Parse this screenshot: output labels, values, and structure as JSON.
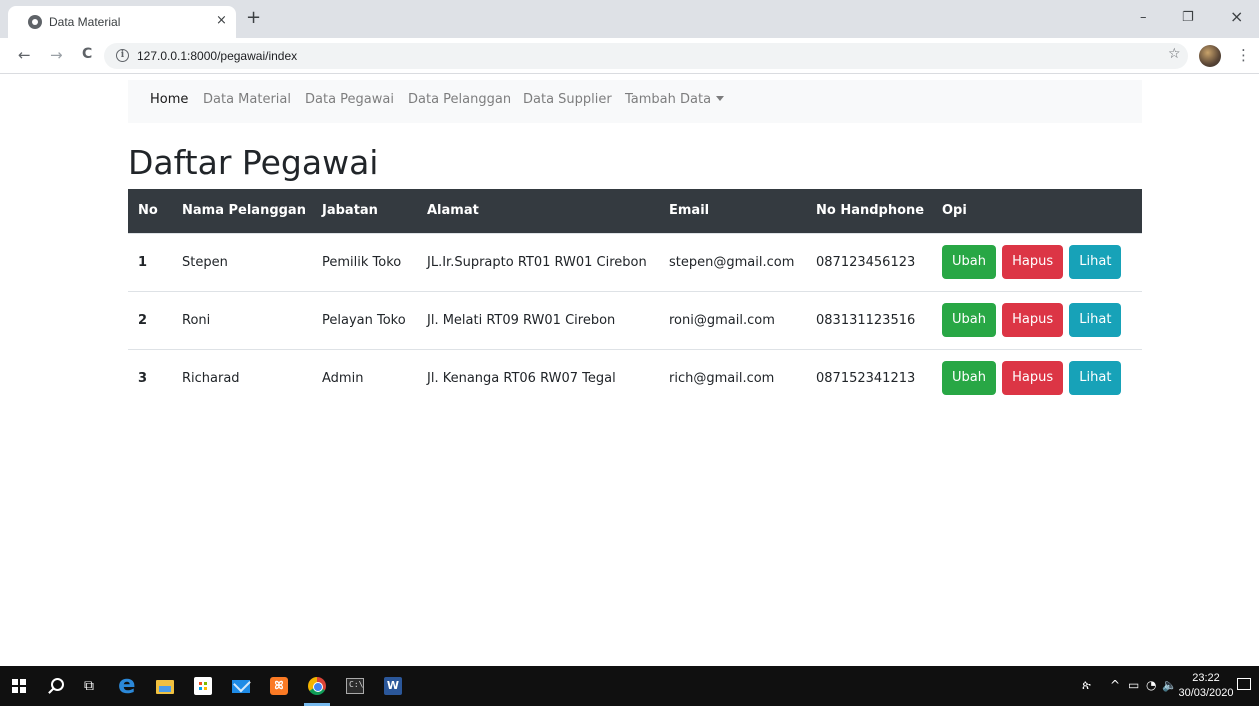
{
  "browser": {
    "tab_title": "Data Material",
    "tab_close": "×",
    "new_tab": "+",
    "window_controls": {
      "minimize": "–",
      "restore": "❐",
      "close": "×"
    },
    "nav": {
      "back": "←",
      "forward": "→",
      "reload": "C"
    },
    "url": "127.0.0.1:8000/pegawai/index",
    "info_icon": "i",
    "star": "☆",
    "menu": "⋮"
  },
  "navbar": {
    "items": [
      {
        "label": "Home",
        "active": true
      },
      {
        "label": "Data Material"
      },
      {
        "label": "Data Pegawai"
      },
      {
        "label": "Data Pelanggan"
      },
      {
        "label": "Data Supplier"
      },
      {
        "label": "Tambah Data",
        "dropdown": true
      }
    ]
  },
  "page": {
    "title": "Daftar Pegawai"
  },
  "table": {
    "headers": [
      "No",
      "Nama Pelanggan",
      "Jabatan",
      "Alamat",
      "Email",
      "No Handphone",
      "Opi"
    ],
    "rows": [
      {
        "no": "1",
        "nama": "Stepen",
        "jabatan": "Pemilik Toko",
        "alamat": "JL.Ir.Suprapto RT01 RW01 Cirebon",
        "email": "stepen@gmail.com",
        "hp": "087123456123"
      },
      {
        "no": "2",
        "nama": "Roni",
        "jabatan": "Pelayan Toko",
        "alamat": "Jl. Melati RT09 RW01 Cirebon",
        "email": "roni@gmail.com",
        "hp": "083131123516"
      },
      {
        "no": "3",
        "nama": "Richarad",
        "jabatan": "Admin",
        "alamat": "Jl. Kenanga RT06 RW07 Tegal",
        "email": "rich@gmail.com",
        "hp": "087152341213"
      }
    ],
    "actions": {
      "edit": "Ubah",
      "delete": "Hapus",
      "view": "Lihat"
    }
  },
  "taskbar": {
    "time": "23:22",
    "date": "30/03/2020",
    "xampp_label": "ꕤ",
    "word_label": "W",
    "cmd_label": "C:\\",
    "edge_label": "e",
    "task_view": "⧉",
    "people": "ጵ",
    "chevron": "^",
    "battery": "▭",
    "wifi": "◔",
    "volume": "🔈"
  },
  "colors": {
    "success": "#28a745",
    "danger": "#dc3545",
    "info": "#17a2b8",
    "table_header": "#343a40",
    "navbar_bg": "#f8f9fa"
  }
}
